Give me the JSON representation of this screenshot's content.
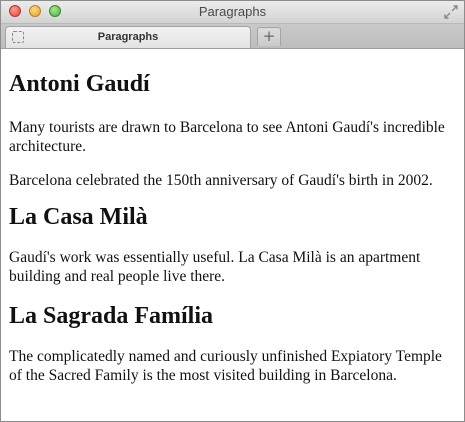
{
  "window": {
    "title": "Paragraphs"
  },
  "tabs": [
    {
      "label": "Paragraphs",
      "active": true
    }
  ],
  "new_tab_label": "+",
  "content": {
    "sections": [
      {
        "heading": "Antoni Gaudí",
        "paragraphs": [
          "Many tourists are drawn to Barcelona to see Antoni Gaudí's incredible architecture.",
          "Barcelona celebrated the 150th anniversary of Gaudí's birth in 2002."
        ]
      },
      {
        "heading": "La Casa Milà",
        "paragraphs": [
          "Gaudí's work was essentially useful. La Casa Milà is an apartment building and real people live there."
        ]
      },
      {
        "heading": "La Sagrada Família",
        "paragraphs": [
          "The complicatedly named and curiously unfinished Expiatory Temple of the Sacred Family is the most visited building in Barcelona."
        ]
      }
    ]
  },
  "icons": {
    "close": "close-button",
    "minimize": "minimize-button",
    "zoom": "zoom-button",
    "fullscreen": "fullscreen-icon",
    "favicon": "blank-page-icon"
  },
  "colors": {
    "close": "#e0443a",
    "minimize": "#e3a21f",
    "zoom": "#4fae3a"
  }
}
